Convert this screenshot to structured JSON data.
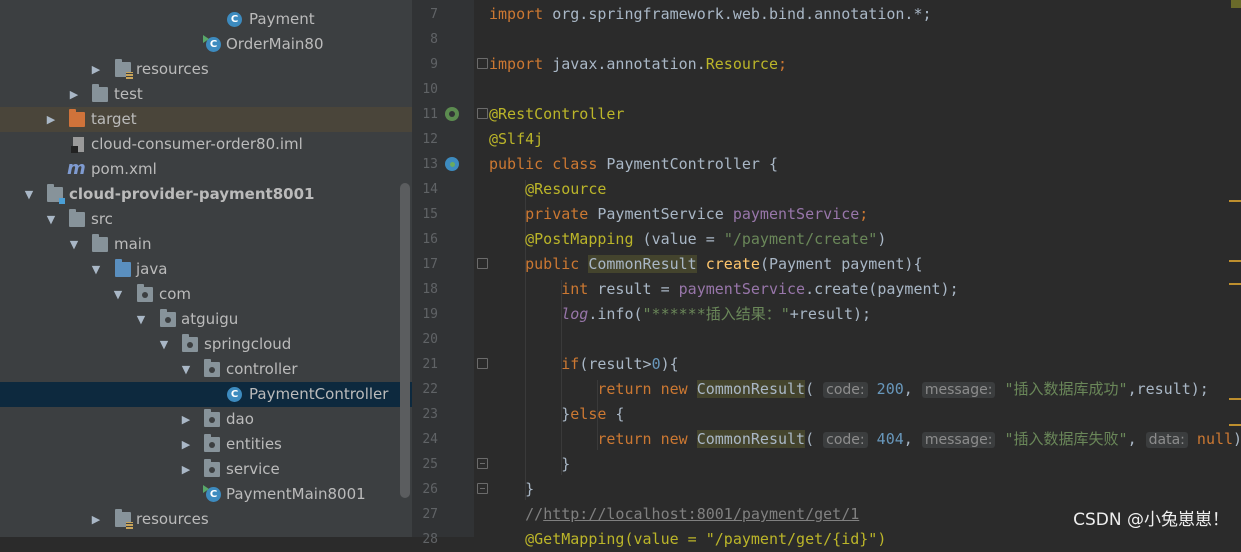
{
  "project_tree": {
    "items": [
      {
        "label": "Payment",
        "icon": "class-icon"
      },
      {
        "label": "OrderMain80",
        "icon": "run-class-icon"
      },
      {
        "label": "resources",
        "icon": "resources-folder-icon"
      },
      {
        "label": "test",
        "icon": "folder-icon"
      },
      {
        "label": "target",
        "icon": "excluded-folder-icon"
      },
      {
        "label": "cloud-consumer-order80.iml",
        "icon": "iml-file-icon"
      },
      {
        "label": "pom.xml",
        "icon": "maven-icon"
      },
      {
        "label": "cloud-provider-payment8001",
        "icon": "module-folder-icon"
      },
      {
        "label": "src",
        "icon": "folder-icon"
      },
      {
        "label": "main",
        "icon": "folder-icon"
      },
      {
        "label": "java",
        "icon": "source-folder-icon"
      },
      {
        "label": "com",
        "icon": "package-icon"
      },
      {
        "label": "atguigu",
        "icon": "package-icon"
      },
      {
        "label": "springcloud",
        "icon": "package-icon"
      },
      {
        "label": "controller",
        "icon": "package-icon"
      },
      {
        "label": "PaymentController",
        "icon": "class-icon"
      },
      {
        "label": "dao",
        "icon": "package-icon"
      },
      {
        "label": "entities",
        "icon": "package-icon"
      },
      {
        "label": "service",
        "icon": "package-icon"
      },
      {
        "label": "PaymentMain8001",
        "icon": "run-class-icon"
      },
      {
        "label": "resources",
        "icon": "resources-folder-icon"
      }
    ]
  },
  "editor": {
    "line_numbers": [
      "7",
      "8",
      "9",
      "10",
      "11",
      "12",
      "13",
      "14",
      "15",
      "16",
      "17",
      "18",
      "19",
      "20",
      "21",
      "22",
      "23",
      "24",
      "25",
      "26",
      "27",
      "28"
    ],
    "code": {
      "l7_kw": "import",
      "l7_rest": " org.springframework.web.bind.annotation.*;",
      "l9_kw": "import",
      "l9_mid": " javax.annotation.",
      "l9_cls": "Resource",
      "l9_end": ";",
      "l11": "@RestController",
      "l12": "@Slf4j",
      "l13_kw": "public class",
      "l13_rest": " PaymentController {",
      "l14": "@Resource",
      "l15_kw": "private",
      "l15_type": " PaymentService ",
      "l15_fld": "paymentService",
      "l15_end": ";",
      "l16_ann": "@PostMapping",
      "l16_open": " (",
      "l16_attr": "value",
      "l16_eq": " = ",
      "l16_str": "\"/payment/create\"",
      "l16_close": ")",
      "l17_kw": "public",
      "l17_type": "CommonResult",
      "l17_fn": "create",
      "l17_rest": "(Payment payment){",
      "l18_kw": "int",
      "l18_mid": " result = ",
      "l18_fld": "paymentService",
      "l18_end": ".create(payment);",
      "l19_log": "log",
      "l19_mid": ".info(",
      "l19_str": "\"******插入结果：\"",
      "l19_end": "+result);",
      "l21_kw": "if",
      "l21_mid": "(result>",
      "l21_num": "0",
      "l21_end": "){",
      "l22_kw": "return new",
      "l22_type": "CommonResult",
      "l22_open": "(",
      "l22_h1": "code:",
      "l22_n": "200",
      "l22_comma": ",",
      "l22_h2": "message:",
      "l22_str": "\"插入数据库成功\"",
      "l22_end": ",result);",
      "l23_close": "}",
      "l23_kw": "else",
      "l23_brace": " {",
      "l24_kw": "return new",
      "l24_type": "CommonResult",
      "l24_open": "(",
      "l24_h1": "code:",
      "l24_n": "404",
      "l24_comma": ",",
      "l24_h2": "message:",
      "l24_str": "\"插入数据库失败\"",
      "l24_comma2": ",",
      "l24_h3": "data:",
      "l24_null": "null",
      "l24_end": ");",
      "l25": "}",
      "l26": "}",
      "l27_slash": "//",
      "l27_url": "http://localhost:8001/payment/get/1",
      "l28": "@GetMapping(value = \"/payment/get/{id}\")"
    }
  },
  "watermark": "CSDN @小兔崽崽！"
}
